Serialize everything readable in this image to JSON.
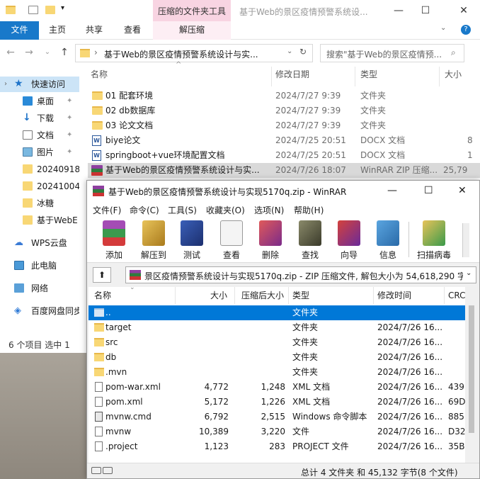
{
  "explorer": {
    "context_tab_title": "压缩的文件夹工具",
    "window_title": "基于Web的景区疫情预警系统设...",
    "caption": {
      "minimize": "—",
      "maximize": "☐",
      "close": "✕"
    },
    "ribbon_tabs": [
      "文件",
      "主页",
      "共享",
      "查看",
      "解压缩"
    ],
    "address": "基于Web的景区疫情预警系统设计与实...",
    "search_placeholder": "搜索\"基于Web的景区疫情预...",
    "nav": [
      {
        "label": "快速访问",
        "icon": "star-icon",
        "pinned": false
      },
      {
        "label": "桌面",
        "icon": "desktop-icon",
        "pinned": true
      },
      {
        "label": "下载",
        "icon": "download-icon",
        "pinned": true
      },
      {
        "label": "文档",
        "icon": "document-icon",
        "pinned": true
      },
      {
        "label": "图片",
        "icon": "picture-icon",
        "pinned": true
      },
      {
        "label": "20240918",
        "icon": "folder-icon",
        "pinned": false
      },
      {
        "label": "20241004",
        "icon": "folder-icon",
        "pinned": false
      },
      {
        "label": "冰糖",
        "icon": "folder-icon",
        "pinned": false
      },
      {
        "label": "基于WebE",
        "icon": "folder-icon",
        "pinned": false
      },
      {
        "label": "WPS云盘",
        "icon": "cloud-icon",
        "pinned": false
      },
      {
        "label": "此电脑",
        "icon": "computer-icon",
        "pinned": false
      },
      {
        "label": "网络",
        "icon": "network-icon",
        "pinned": false
      },
      {
        "label": "百度网盘同步",
        "icon": "baidu-icon",
        "pinned": false
      }
    ],
    "columns": [
      "名称",
      "修改日期",
      "类型",
      "大小"
    ],
    "files": [
      {
        "name": "01 配套环境",
        "date": "2024/7/27 9:39",
        "type": "文件夹",
        "size": "",
        "icon": "folder"
      },
      {
        "name": "02 db数据库",
        "date": "2024/7/27 9:39",
        "type": "文件夹",
        "size": "",
        "icon": "folder"
      },
      {
        "name": "03 论文文档",
        "date": "2024/7/27 9:39",
        "type": "文件夹",
        "size": "",
        "icon": "folder"
      },
      {
        "name": "biye论文",
        "date": "2024/7/25 20:51",
        "type": "DOCX 文档",
        "size": "8",
        "icon": "doc"
      },
      {
        "name": "springboot+vue环境配置文档",
        "date": "2024/7/25 20:51",
        "type": "DOCX 文档",
        "size": "1",
        "icon": "doc"
      },
      {
        "name": "基于Web的景区疫情预警系统设计与实...",
        "date": "2024/7/26 18:07",
        "type": "WinRAR ZIP 压缩...",
        "size": "25,79",
        "icon": "rar"
      }
    ],
    "status": "6 个项目    选中 1"
  },
  "winrar": {
    "title": "基于Web的景区疫情预警系统设计与实现5170q.zip - WinRAR",
    "menu": [
      "文件(F)",
      "命令(C)",
      "工具(S)",
      "收藏夹(O)",
      "选项(N)",
      "帮助(H)"
    ],
    "toolbar": [
      {
        "label": "添加",
        "icon": "add-icon"
      },
      {
        "label": "解压到",
        "icon": "extract-icon"
      },
      {
        "label": "测试",
        "icon": "test-icon"
      },
      {
        "label": "查看",
        "icon": "view-icon"
      },
      {
        "label": "删除",
        "icon": "delete-icon"
      },
      {
        "label": "查找",
        "icon": "find-icon"
      },
      {
        "label": "向导",
        "icon": "wizard-icon"
      },
      {
        "label": "信息",
        "icon": "info-icon"
      },
      {
        "label": "扫描病毒",
        "icon": "virus-scan-icon"
      }
    ],
    "path": "景区疫情预警系统设计与实现5170q.zip - ZIP 压缩文件, 解包大小为 54,618,290 字节",
    "columns": [
      "名称",
      "大小",
      "压缩后大小",
      "类型",
      "修改时间",
      "CRC"
    ],
    "rows": [
      {
        "name": "..",
        "size": "",
        "packed": "",
        "type": "文件夹",
        "modified": "",
        "crc": "",
        "icon": "folder"
      },
      {
        "name": "target",
        "size": "",
        "packed": "",
        "type": "文件夹",
        "modified": "2024/7/26 16...",
        "crc": "",
        "icon": "folder"
      },
      {
        "name": "src",
        "size": "",
        "packed": "",
        "type": "文件夹",
        "modified": "2024/7/26 16...",
        "crc": "",
        "icon": "folder"
      },
      {
        "name": "db",
        "size": "",
        "packed": "",
        "type": "文件夹",
        "modified": "2024/7/26 16...",
        "crc": "",
        "icon": "folder"
      },
      {
        "name": ".mvn",
        "size": "",
        "packed": "",
        "type": "文件夹",
        "modified": "2024/7/26 16...",
        "crc": "",
        "icon": "folder"
      },
      {
        "name": "pom-war.xml",
        "size": "4,772",
        "packed": "1,248",
        "type": "XML 文档",
        "modified": "2024/7/26 16...",
        "crc": "439",
        "icon": "file"
      },
      {
        "name": "pom.xml",
        "size": "5,172",
        "packed": "1,226",
        "type": "XML 文档",
        "modified": "2024/7/26 16...",
        "crc": "69D",
        "icon": "file"
      },
      {
        "name": "mvnw.cmd",
        "size": "6,792",
        "packed": "2,515",
        "type": "Windows 命令脚本",
        "modified": "2024/7/26 16...",
        "crc": "885",
        "icon": "file"
      },
      {
        "name": "mvnw",
        "size": "10,389",
        "packed": "3,220",
        "type": "文件",
        "modified": "2024/7/26 16...",
        "crc": "D32",
        "icon": "file"
      },
      {
        "name": ".project",
        "size": "1,123",
        "packed": "283",
        "type": "PROJECT 文件",
        "modified": "2024/7/26 16...",
        "crc": "35B",
        "icon": "file"
      }
    ],
    "status": "总计 4 文件夹 和 45,132 字节(8 个文件)"
  }
}
